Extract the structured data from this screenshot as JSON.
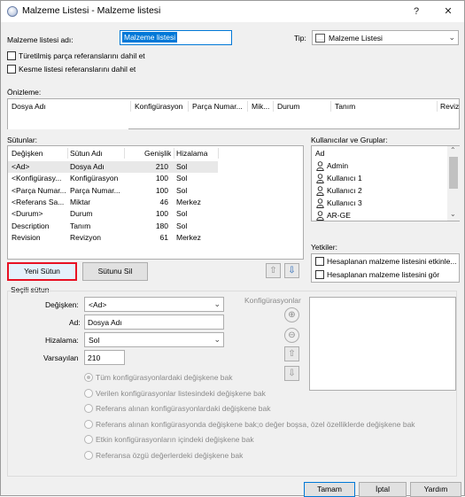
{
  "window": {
    "title": "Malzeme Listesi - Malzeme listesi",
    "help_glyph": "?",
    "close_glyph": "✕"
  },
  "header": {
    "name_label": "Malzeme listesi adı:",
    "name_value": "Malzeme listesi",
    "type_label": "Tip:",
    "type_value": "Malzeme Listesi",
    "include_derived_label": "Türetilmiş parça referanslarını dahil et",
    "include_cutlist_label": "Kesme listesi referanslarını dahil et"
  },
  "preview": {
    "label": "Önizleme:",
    "columns": [
      "Dosya Adı",
      "Konfigürasyon",
      "Parça Numar...",
      "Mik...",
      "Durum",
      "Tanım",
      "Reviz"
    ]
  },
  "columns_section": {
    "label": "Sütunlar:",
    "headers": [
      "Değişken",
      "Sütun Adı",
      "Genişlik",
      "Hizalama"
    ],
    "rows": [
      [
        "<Ad>",
        "Dosya Adı",
        "210",
        "Sol"
      ],
      [
        "<Konfigürasy...",
        "Konfigürasyon",
        "100",
        "Sol"
      ],
      [
        "<Parça Numar...",
        "Parça Numar...",
        "100",
        "Sol"
      ],
      [
        "<Referans Sa...",
        "Miktar",
        "46",
        "Merkez"
      ],
      [
        "<Durum>",
        "Durum",
        "100",
        "Sol"
      ],
      [
        "Description",
        "Tanım",
        "180",
        "Sol"
      ],
      [
        "Revision",
        "Revizyon",
        "61",
        "Merkez"
      ]
    ],
    "new_column_label": "Yeni Sütun",
    "delete_column_label": "Sütunu Sil",
    "move_up_glyph": "⇧",
    "move_down_glyph": "⇩"
  },
  "users_section": {
    "label": "Kullanıcılar ve Gruplar:",
    "items": [
      "Ad",
      "Admin",
      "Kullanıcı 1",
      "Kullanıcı 2",
      "Kullanıcı 3",
      "AR-GE"
    ]
  },
  "permissions_section": {
    "label": "Yetkiler:",
    "items": [
      "Hesaplanan malzeme listesini etkinle...",
      "Hesaplanan malzeme listesini gör"
    ]
  },
  "selected_column": {
    "label": "Seçili sütun",
    "variable_label": "Değişken:",
    "variable_value": "<Ad>",
    "name_label": "Ad:",
    "name_value": "Dosya Adı",
    "alignment_label": "Hizalama:",
    "alignment_value": "Sol",
    "default_label": "Varsayılan",
    "default_value": "210",
    "configurations_label": "Konfigürasyonlar",
    "radio_options": [
      "Tüm konfigürasyonlardaki değişkene bak",
      "Verilen konfigürasyonlar listesindeki değişkene bak",
      "Referans alınan konfigürasyonlardaki değişkene bak",
      "Referans alınan konfigürasyonda değişkene bak;o değer boşsa, özel özelliklerde değişkene bak",
      "Etkin konfigürasyonların içindeki değişkene bak",
      "Referansa özgü değerlerdeki değişkene bak"
    ]
  },
  "footer": {
    "ok_label": "Tamam",
    "cancel_label": "İptal",
    "help_label": "Yardım"
  },
  "colors": {
    "highlight_border": "#e81123",
    "selection_blue": "#0078d7",
    "row_selected": "#e8e8e8"
  }
}
